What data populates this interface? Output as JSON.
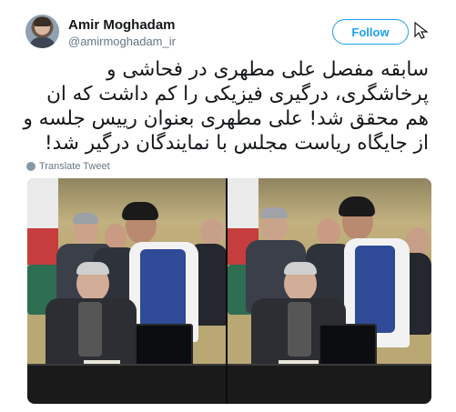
{
  "author": {
    "name": "Amir Moghadam",
    "handle": "@amirmoghadam_ir",
    "avatar_icon": "profile-avatar"
  },
  "follow_label": "Follow",
  "tweet": {
    "text": "سابقه مفصل علی مطهری در فحاشی و پرخاشگری، درگیری فیزیکی را کم داشت که ان هم محقق شد! علی مطهری بعنوان رییس جلسه و از جایگاه ریاست مجلس با نمایندگان درگیر شد!",
    "translate_label": "Translate Tweet"
  },
  "colors": {
    "accent": "#1da1f2",
    "secondary_text": "#657786",
    "primary_text": "#14171a"
  },
  "media": {
    "photos": [
      "photo-left",
      "photo-right"
    ]
  }
}
